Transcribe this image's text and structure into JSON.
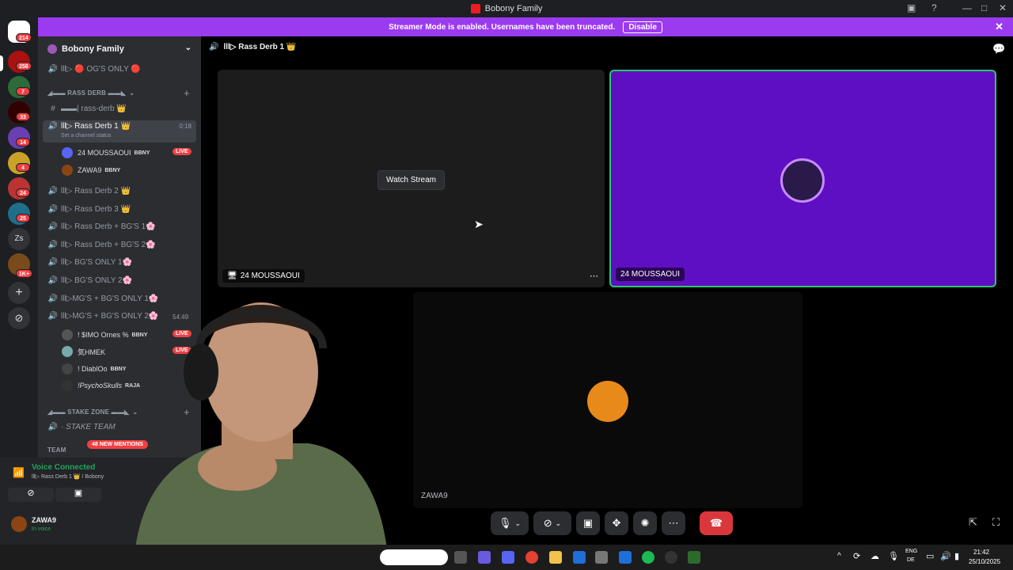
{
  "window": {
    "title": "Bobony Family"
  },
  "banner": {
    "text": "Streamer Mode is enabled. Usernames have been truncated.",
    "button": "Disable",
    "color": "#9b3bf0"
  },
  "rail": {
    "badges": [
      "214",
      "258",
      "7",
      "33",
      "14",
      "4",
      "24",
      "25",
      "1K+"
    ],
    "text_icon": "Zs"
  },
  "sidebar": {
    "guild_name": "Bobony Family",
    "items": [
      {
        "label": "lll▷ 🔴 OG'S ONLY 🔴"
      },
      {
        "label": "◢▬▬ RASS DERB ▬▬◣"
      },
      {
        "label": "▬▬| rass-derb 👑"
      },
      {
        "label": "lll▷ Rass Derb 1 👑",
        "timer": "0:18",
        "status": "Set a channel status"
      },
      {
        "label": "lll▷ Rass Derb 2 👑"
      },
      {
        "label": "lll▷ Rass Derb 3 👑"
      },
      {
        "label": "lll▷ Rass Derb + BG'S 1🌸"
      },
      {
        "label": "lll▷ Rass Derb + BG'S 2🌸"
      },
      {
        "label": "lll▷ BG'S ONLY 1🌸"
      },
      {
        "label": "lll▷ BG'S ONLY 2🌸"
      },
      {
        "label": "lll▷MG'S + BG'S ONLY 1🌸"
      },
      {
        "label": "lll▷MG'S + BG'S ONLY 2🌸",
        "timer": "54:49"
      },
      {
        "label": "◢▬▬ STAKE ZONE ▬▬◣"
      },
      {
        "label": "· STAKE TEAM"
      },
      {
        "label": "TEAM"
      }
    ],
    "voice_users_1": [
      {
        "name": "24 MOUSSAOUI",
        "tag": "BBNY",
        "live": "LIVE"
      },
      {
        "name": "ZAWA9",
        "tag": "BBNY"
      }
    ],
    "voice_users_2": [
      {
        "name": "! $IMO Ornes %",
        "tag": "BBNY",
        "live": "LIVE"
      },
      {
        "name": "気HMEK",
        "live": "LIVE"
      },
      {
        "name": "! DiablOo",
        "tag": "BBNY"
      },
      {
        "name": "!PsychoSkulls",
        "tag": "RAJA"
      }
    ],
    "mentions": "48 NEW MENTIONS"
  },
  "voice_panel": {
    "status": "Voice Connected",
    "channel": "lll▷ Rass Derb 1 👑 / Bobony",
    "user": "ZAWA9",
    "user_status": "In voice"
  },
  "main": {
    "channel_title": "lll▷ Rass Derb 1 👑",
    "watch_label": "Watch Stream",
    "tile1_name": "24 MOUSSAOUI",
    "tile2_name": "24 MOUSSAOUI",
    "tile3_name": "ZAWA9"
  },
  "taskbar": {
    "lang": "ENG",
    "region": "DE",
    "time": "21:42",
    "date": "25/10/2025"
  }
}
